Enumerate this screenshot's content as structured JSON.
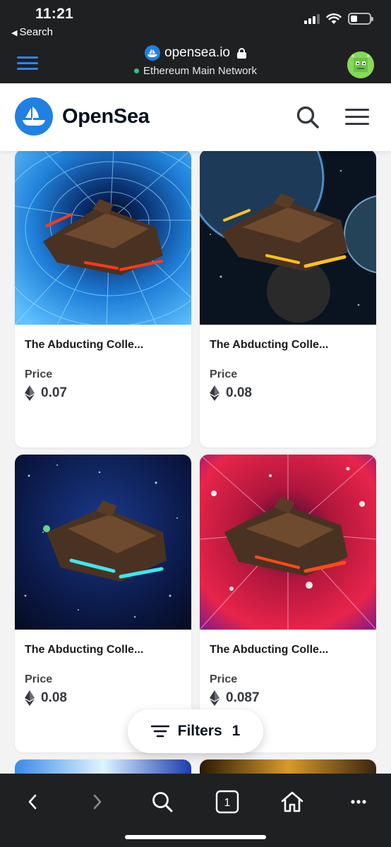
{
  "status_bar": {
    "time": "11:21",
    "back_app_label": "Search"
  },
  "browser": {
    "url": "opensea.io",
    "network": "Ethereum Main Network"
  },
  "header": {
    "brand": "OpenSea"
  },
  "cards": [
    {
      "name": "The Abducting Colle...",
      "price_label": "Price",
      "price": "0.07",
      "trail_color": "#ff3a1a"
    },
    {
      "name": "The Abducting Colle...",
      "price_label": "Price",
      "price": "0.08",
      "trail_color": "#ffc21a"
    },
    {
      "name": "The Abducting Colle...",
      "price_label": "Price",
      "price": "0.08",
      "trail_color": "#3fe6ee"
    },
    {
      "name": "The Abducting Colle...",
      "price_label": "Price",
      "price": "0.087",
      "trail_color": "#ff4a1a"
    }
  ],
  "filters": {
    "label": "Filters",
    "count": "1"
  },
  "colors": {
    "brand_blue": "#2081e2",
    "chrome_dark": "#1f2022"
  }
}
